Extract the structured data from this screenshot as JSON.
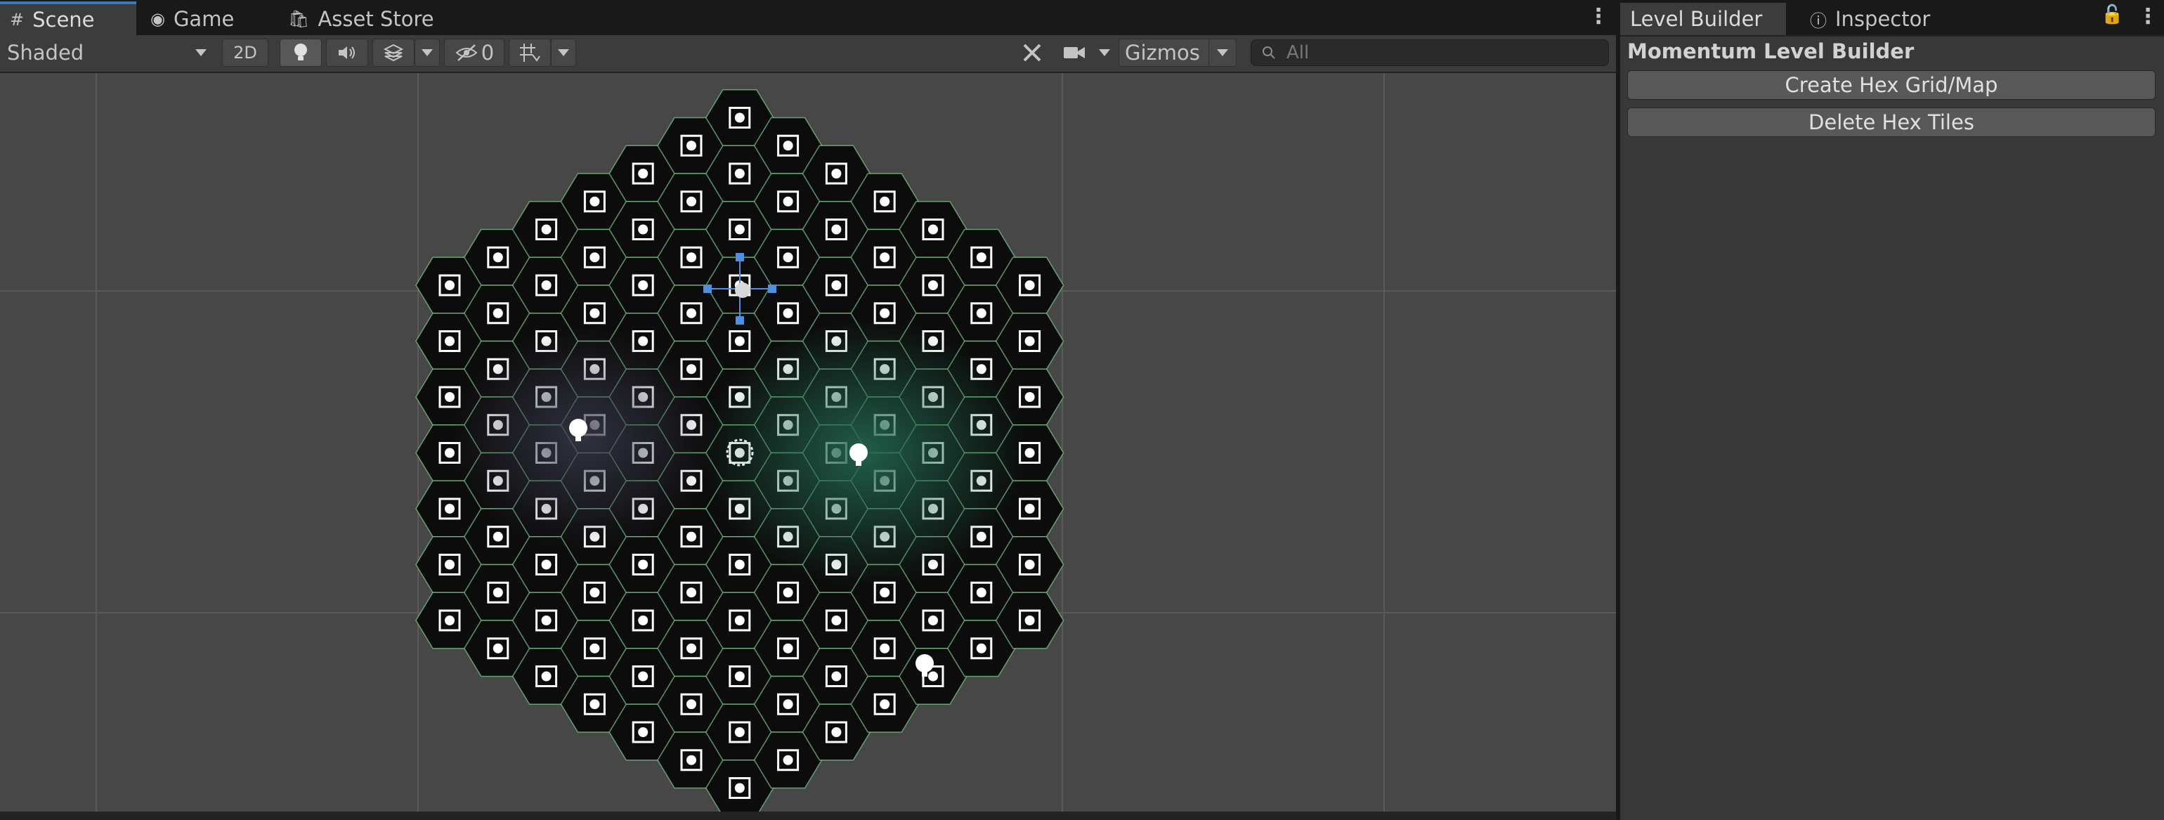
{
  "scene_tabs": [
    {
      "label": "Scene",
      "icon": "grid-icon",
      "active": true
    },
    {
      "label": "Game",
      "icon": "gamepad-icon",
      "active": false
    },
    {
      "label": "Asset Store",
      "icon": "shopping-bag-icon",
      "active": false
    }
  ],
  "right_tabs": [
    {
      "label": "Level Builder",
      "active": true
    },
    {
      "label": "Inspector",
      "icon": "info-icon",
      "active": false
    }
  ],
  "toolbar": {
    "draw_mode": "Shaded",
    "mode_2d": "2D",
    "hidden_count": "0",
    "gizmos_label": "Gizmos",
    "search_placeholder": "All",
    "icons": [
      "lightbulb-icon",
      "audio-icon",
      "effects-icon",
      "visibility-icon",
      "grid-snap-icon",
      "tools-icon",
      "camera-icon",
      "search-icon"
    ]
  },
  "panel": {
    "title": "Momentum Level Builder",
    "buttons": [
      "Create Hex Grid/Map",
      "Delete Hex Tiles"
    ]
  },
  "scene": {
    "hex_columns": 13,
    "hex_radius": 6,
    "colors": {
      "viewport_bg": "#474747",
      "grid_line": "#5a5a5a",
      "hex_fill": "#0c0c0c",
      "hex_edge": "#7fd28f",
      "glow": "#1f5a44",
      "icon": "#ffffff",
      "selection": "#4f8fe0"
    }
  }
}
